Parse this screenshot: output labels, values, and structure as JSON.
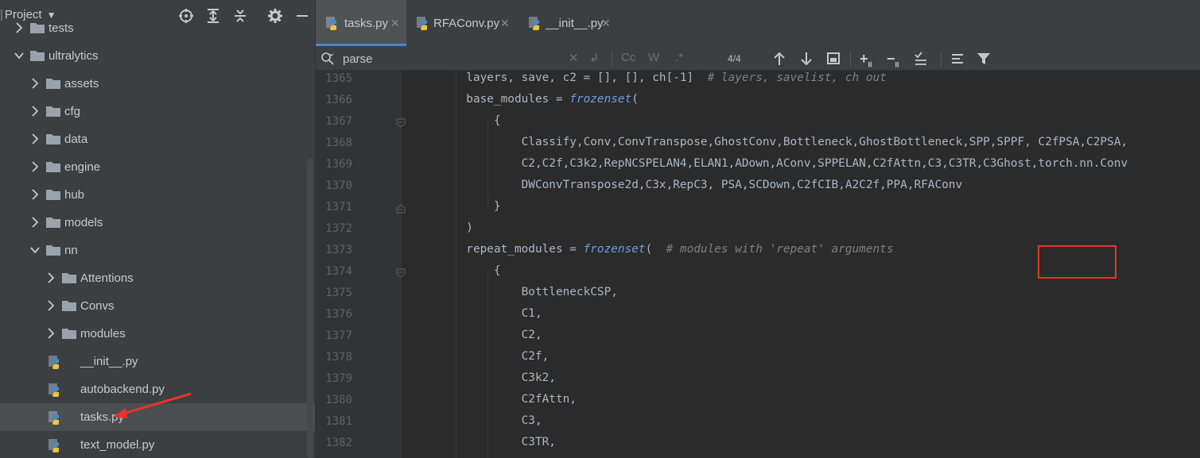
{
  "project_panel": {
    "title": "Project",
    "tree": [
      {
        "label": "tests",
        "depth": 0,
        "type": "folder",
        "expanded": false
      },
      {
        "label": "ultralytics",
        "depth": 0,
        "type": "folder",
        "expanded": true
      },
      {
        "label": "assets",
        "depth": 1,
        "type": "folder",
        "expanded": false
      },
      {
        "label": "cfg",
        "depth": 1,
        "type": "folder",
        "expanded": false
      },
      {
        "label": "data",
        "depth": 1,
        "type": "folder",
        "expanded": false
      },
      {
        "label": "engine",
        "depth": 1,
        "type": "folder",
        "expanded": false
      },
      {
        "label": "hub",
        "depth": 1,
        "type": "folder",
        "expanded": false
      },
      {
        "label": "models",
        "depth": 1,
        "type": "folder",
        "expanded": false
      },
      {
        "label": "nn",
        "depth": 1,
        "type": "folder",
        "expanded": true
      },
      {
        "label": "Attentions",
        "depth": 2,
        "type": "folder",
        "expanded": false
      },
      {
        "label": "Convs",
        "depth": 2,
        "type": "folder",
        "expanded": false
      },
      {
        "label": "modules",
        "depth": 2,
        "type": "folder",
        "expanded": false
      },
      {
        "label": "__init__.py",
        "depth": 2,
        "type": "py"
      },
      {
        "label": "autobackend.py",
        "depth": 2,
        "type": "py"
      },
      {
        "label": "tasks.py",
        "depth": 2,
        "type": "py",
        "selected": true
      },
      {
        "label": "text_model.py",
        "depth": 2,
        "type": "py"
      }
    ]
  },
  "tabs": [
    {
      "label": "tasks.py",
      "active": true
    },
    {
      "label": "RFAConv.py",
      "active": false
    },
    {
      "label": "__init__.py",
      "active": false
    }
  ],
  "search": {
    "query": "parse",
    "case_label": "Cc",
    "word_label": "W",
    "regex_label": ".*",
    "match_count": "4/4"
  },
  "editor": {
    "lines": [
      {
        "num": "1365",
        "text": "        layers, save, c2 = [], [], ch[-1]  # layers, savelist, ch out"
      },
      {
        "num": "1366",
        "text": "        base_modules = frozenset("
      },
      {
        "num": "1367",
        "text": "            {"
      },
      {
        "num": "1368",
        "text": "                Classify,Conv,ConvTranspose,GhostConv,Bottleneck,GhostBottleneck,SPP,SPPF, C2fPSA,C2PSA,"
      },
      {
        "num": "1369",
        "text": "                C2,C2f,C3k2,RepNCSPELAN4,ELAN1,ADown,AConv,SPPELAN,C2fAttn,C3,C3TR,C3Ghost,torch.nn.Conv"
      },
      {
        "num": "1370",
        "text": "                DWConvTranspose2d,C3x,RepC3, PSA,SCDown,C2fCIB,A2C2f,PPA,RFAConv"
      },
      {
        "num": "1371",
        "text": "            }"
      },
      {
        "num": "1372",
        "text": "        )"
      },
      {
        "num": "1373",
        "text": "        repeat_modules = frozenset(  # modules with 'repeat' arguments"
      },
      {
        "num": "1374",
        "text": "            {"
      },
      {
        "num": "1375",
        "text": "                BottleneckCSP,"
      },
      {
        "num": "1376",
        "text": "                C1,"
      },
      {
        "num": "1377",
        "text": "                C2,"
      },
      {
        "num": "1378",
        "text": "                C2f,"
      },
      {
        "num": "1379",
        "text": "                C3k2,"
      },
      {
        "num": "1380",
        "text": "                C2fAttn,"
      },
      {
        "num": "1381",
        "text": "                C3,"
      },
      {
        "num": "1382",
        "text": "                C3TR,"
      }
    ]
  },
  "colors": {
    "panel_bg": "#3c3f41",
    "editor_bg": "#2b2b2b",
    "gutter_bg": "#313335",
    "accent": "#4a88c7",
    "annotation_red": "#e5342b",
    "keyword_italic": "#6a9fe0",
    "comment": "#808080"
  }
}
